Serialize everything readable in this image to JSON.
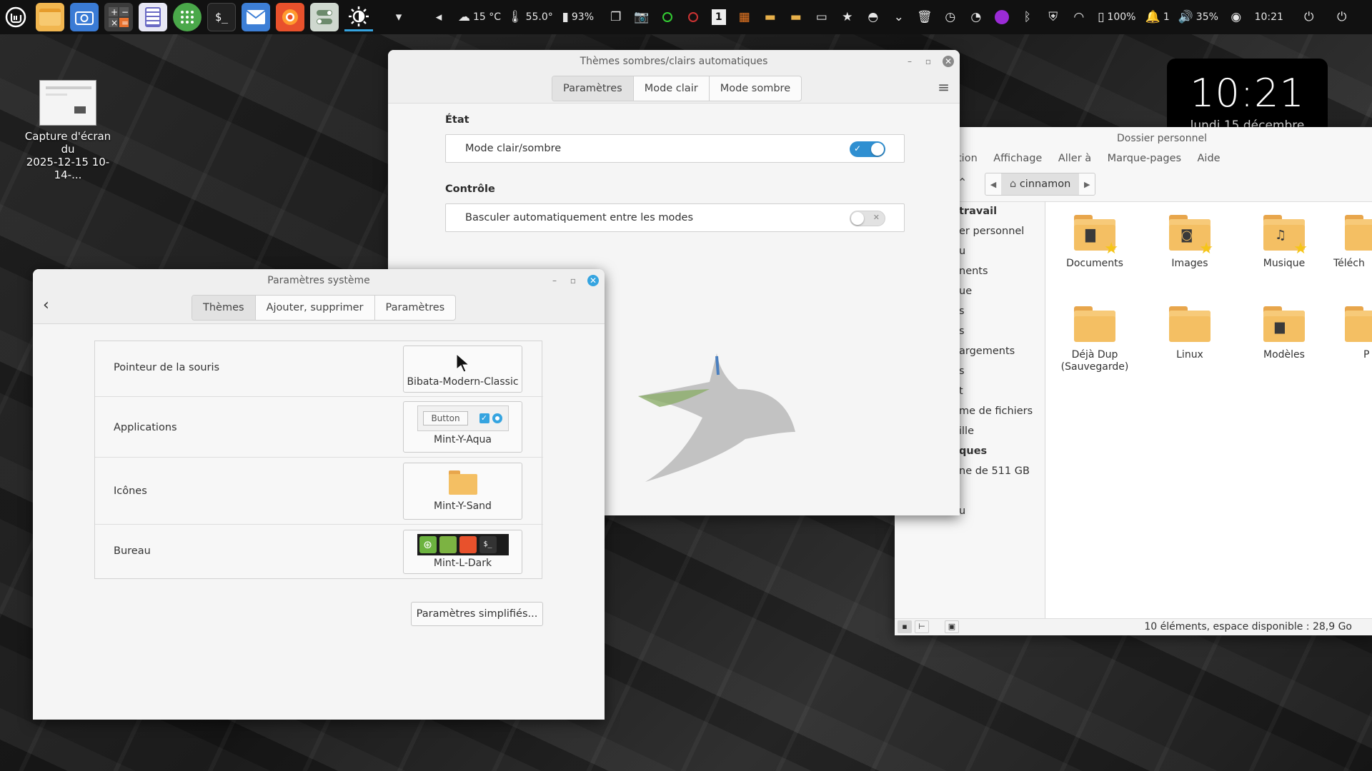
{
  "panel": {
    "apps": [
      "menu-icon",
      "files-icon",
      "screenshot-icon",
      "calculator-icon",
      "text-editor-icon",
      "spreadsheet-icon",
      "terminal-icon",
      "mail-icon",
      "firefox-icon",
      "toggle-settings-icon",
      "brightness-icon"
    ],
    "weather": "15 °C",
    "temperature": "55.0°",
    "mouse_battery": "93%",
    "battery": "100%",
    "notifications": "1",
    "workspace": "1",
    "volume": "35%",
    "time": "10:21"
  },
  "desktop": {
    "file_label_line1": "Capture d'écran du",
    "file_label_line2": "2025-12-15 10-14-..."
  },
  "clock_desklet": {
    "time": "10:21",
    "date": "lundi 15 décembre"
  },
  "themes_window": {
    "title": "Thèmes sombres/clairs automatiques",
    "tabs": [
      "Paramètres",
      "Mode clair",
      "Mode sombre"
    ],
    "active_tab": "Paramètres",
    "section_state": "État",
    "row_mode": "Mode clair/sombre",
    "row_mode_on": true,
    "section_control": "Contrôle",
    "row_auto": "Basculer automatiquement entre les modes",
    "row_auto_on": false
  },
  "file_manager": {
    "title": "Dossier personnel",
    "menu": [
      "tion",
      "Affichage",
      "Aller à",
      "Marque-pages",
      "Aide"
    ],
    "path": "cinnamon",
    "sidebar": [
      "travail",
      "er personnel",
      "u",
      "nents",
      "ue",
      "s",
      "s",
      "argements",
      "s",
      "t",
      "me de fichiers",
      "ille",
      "ques",
      "ne de 511 GB",
      "",
      "u"
    ],
    "folders": [
      {
        "name": "Documents",
        "emblem": "doc",
        "star": true
      },
      {
        "name": "Images",
        "emblem": "camera",
        "star": true
      },
      {
        "name": "Musique",
        "emblem": "music",
        "star": true
      },
      {
        "name": "Téléch",
        "emblem": "",
        "star": false
      },
      {
        "name": "Déjà Dup (Sauvegarde)",
        "emblem": "",
        "star": false
      },
      {
        "name": "Linux",
        "emblem": "",
        "star": false
      },
      {
        "name": "Modèles",
        "emblem": "file",
        "star": false
      },
      {
        "name": "P",
        "emblem": "",
        "star": false
      }
    ],
    "status": "10 éléments, espace disponible : 28,9 Go"
  },
  "settings_window": {
    "title": "Paramètres système",
    "tabs": [
      "Thèmes",
      "Ajouter, supprimer",
      "Paramètres"
    ],
    "active_tab": "Thèmes",
    "rows": [
      {
        "label": "Pointeur de la souris",
        "value": "Bibata-Modern-Classic"
      },
      {
        "label": "Applications",
        "value": "Mint-Y-Aqua",
        "preview_button": "Button"
      },
      {
        "label": "Icônes",
        "value": "Mint-Y-Sand"
      },
      {
        "label": "Bureau",
        "value": "Mint-L-Dark"
      }
    ],
    "simple_button": "Paramètres simplifiés..."
  },
  "colors": {
    "accent": "#35a4e0",
    "folder": "#f4bf63",
    "toggle_on": "#2f8fd1"
  }
}
